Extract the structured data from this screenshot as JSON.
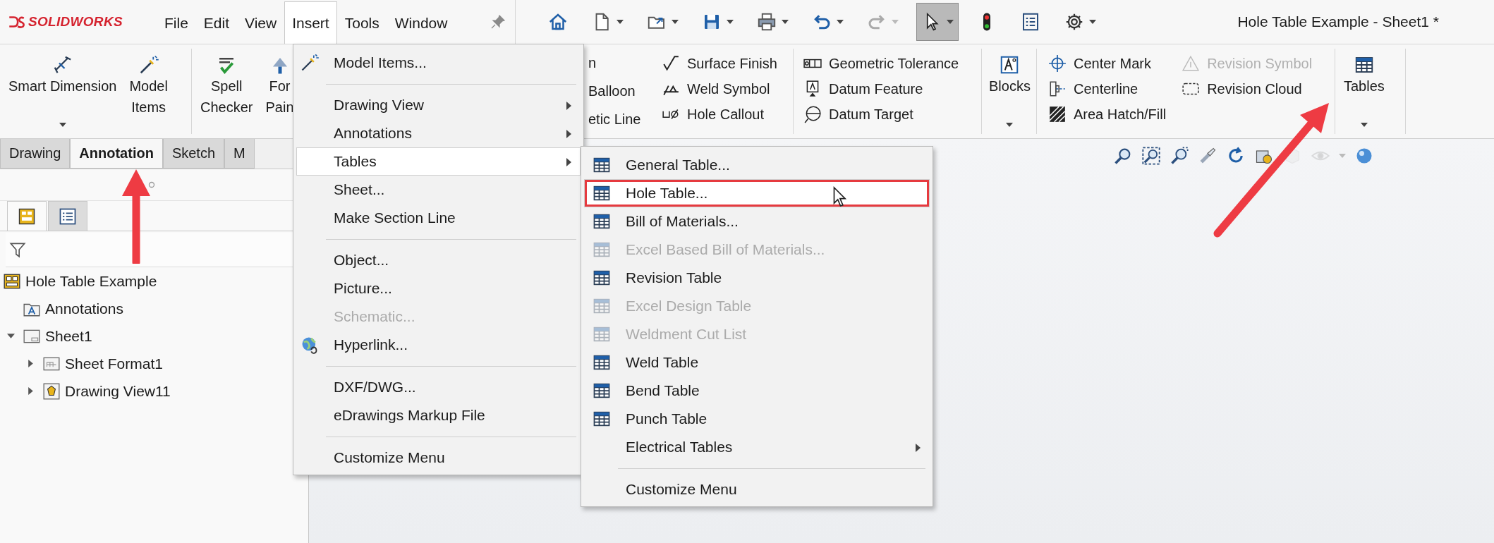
{
  "logo": "SOLIDWORKS",
  "menu_bar": [
    {
      "label": "File",
      "selected": false
    },
    {
      "label": "Edit",
      "selected": false
    },
    {
      "label": "View",
      "selected": false
    },
    {
      "label": "Insert",
      "selected": true
    },
    {
      "label": "Tools",
      "selected": false
    },
    {
      "label": "Window",
      "selected": false
    }
  ],
  "quick_access": [
    {
      "dropdown": false,
      "selected": false,
      "disabled": false
    },
    {
      "dropdown": true,
      "selected": false,
      "disabled": false
    },
    {
      "dropdown": true,
      "selected": false,
      "disabled": false
    },
    {
      "dropdown": true,
      "selected": false,
      "disabled": false
    },
    {
      "dropdown": true,
      "selected": false,
      "disabled": false
    },
    {
      "dropdown": true,
      "selected": false,
      "disabled": false
    },
    {
      "dropdown": true,
      "selected": false,
      "disabled": true
    },
    {
      "dropdown": true,
      "selected": true,
      "disabled": false
    },
    {
      "dropdown": false,
      "selected": false,
      "disabled": false
    },
    {
      "dropdown": false,
      "selected": false,
      "disabled": false
    },
    {
      "dropdown": true,
      "selected": false,
      "disabled": false
    }
  ],
  "window_title": "Hole Table Example - Sheet1 *",
  "ribbon": [
    {
      "kind": "large",
      "items": [
        {
          "lines": [
            "Smart Dimension"
          ],
          "dropdown": true
        },
        {
          "lines": [
            "Model",
            "Items"
          ],
          "dropdown": false
        }
      ]
    },
    {
      "kind": "large",
      "items": [
        {
          "lines": [
            "Spell",
            "Checker"
          ],
          "dropdown": false
        },
        {
          "lines": [
            "For",
            "Pain"
          ],
          "dropdown": false
        }
      ]
    },
    {
      "kind": "partial",
      "columns": [
        [
          {
            "label": "n"
          },
          {
            "label": "Balloon"
          },
          {
            "label": "etic Line"
          }
        ]
      ]
    },
    {
      "kind": "small",
      "columns": [
        [
          {
            "label": "Surface Finish",
            "disabled": false
          },
          {
            "label": "Weld Symbol",
            "disabled": false
          },
          {
            "label": "Hole Callout",
            "disabled": false
          }
        ]
      ]
    },
    {
      "kind": "small",
      "columns": [
        [
          {
            "label": "Geometric Tolerance",
            "disabled": false
          },
          {
            "label": "Datum Feature",
            "disabled": false
          },
          {
            "label": "Datum Target",
            "disabled": false
          }
        ]
      ]
    },
    {
      "kind": "large",
      "items": [
        {
          "lines": [
            "Blocks"
          ],
          "dropdown": true
        }
      ]
    },
    {
      "kind": "small",
      "columns": [
        [
          {
            "label": "Center Mark",
            "disabled": false
          },
          {
            "label": "Centerline",
            "disabled": false
          },
          {
            "label": "Area Hatch/Fill",
            "disabled": false
          }
        ],
        [
          {
            "label": "Revision Symbol",
            "disabled": true
          },
          {
            "label": "Revision Cloud",
            "disabled": false
          }
        ]
      ]
    },
    {
      "kind": "large",
      "items": [
        {
          "lines": [
            "Tables"
          ],
          "dropdown": true
        }
      ]
    }
  ],
  "tabs": [
    {
      "label": "Drawing",
      "selected": false
    },
    {
      "label": "Annotation",
      "selected": true
    },
    {
      "label": "Sketch",
      "selected": false
    },
    {
      "label": "M",
      "selected": false
    }
  ],
  "panel_tabs": [
    {
      "selected": true
    },
    {
      "selected": false
    }
  ],
  "tree": [
    {
      "label": "Hole Table Example",
      "children": [
        {
          "label": "Annotations"
        },
        {
          "label": "Sheet1",
          "expanded": true,
          "children": [
            {
              "label": "Sheet Format1",
              "expanded": false
            },
            {
              "label": "Drawing View11",
              "expanded": false
            }
          ]
        }
      ]
    }
  ],
  "insert_menu": [
    {
      "kind": "item",
      "label": "Model Items...",
      "disabled": false,
      "submenu": false,
      "selected": false
    },
    {
      "kind": "separator"
    },
    {
      "kind": "item",
      "label": "Drawing View",
      "disabled": false,
      "submenu": true,
      "selected": false
    },
    {
      "kind": "item",
      "label": "Annotations",
      "disabled": false,
      "submenu": true,
      "selected": false
    },
    {
      "kind": "item",
      "label": "Tables",
      "disabled": false,
      "submenu": true,
      "selected": true
    },
    {
      "kind": "item",
      "label": "Sheet...",
      "disabled": false,
      "submenu": false,
      "selected": false
    },
    {
      "kind": "item",
      "label": "Make Section Line",
      "disabled": false,
      "submenu": false,
      "selected": false
    },
    {
      "kind": "separator"
    },
    {
      "kind": "item",
      "label": "Object...",
      "disabled": false,
      "submenu": false,
      "selected": false
    },
    {
      "kind": "item",
      "label": "Picture...",
      "disabled": false,
      "submenu": false,
      "selected": false
    },
    {
      "kind": "item",
      "label": "Schematic...",
      "disabled": true,
      "submenu": false,
      "selected": false
    },
    {
      "kind": "item",
      "label": "Hyperlink...",
      "disabled": false,
      "submenu": false,
      "selected": false
    },
    {
      "kind": "separator"
    },
    {
      "kind": "item",
      "label": "DXF/DWG...",
      "disabled": false,
      "submenu": false,
      "selected": false
    },
    {
      "kind": "item",
      "label": "eDrawings Markup File",
      "disabled": false,
      "submenu": false,
      "selected": false
    },
    {
      "kind": "separator"
    },
    {
      "kind": "item",
      "label": "Customize Menu",
      "disabled": false,
      "submenu": false,
      "selected": false
    }
  ],
  "tables_menu": [
    {
      "kind": "item",
      "label": "General Table...",
      "disabled": false,
      "submenu": false,
      "selected": false,
      "callout": false
    },
    {
      "kind": "item",
      "label": "Hole Table...",
      "disabled": false,
      "submenu": false,
      "selected": true,
      "callout": true
    },
    {
      "kind": "item",
      "label": "Bill of Materials...",
      "disabled": false,
      "submenu": false,
      "selected": false,
      "callout": false
    },
    {
      "kind": "item",
      "label": "Excel Based Bill of Materials...",
      "disabled": true,
      "submenu": false,
      "selected": false,
      "callout": false
    },
    {
      "kind": "item",
      "label": "Revision Table",
      "disabled": false,
      "submenu": false,
      "selected": false,
      "callout": false
    },
    {
      "kind": "item",
      "label": "Excel Design Table",
      "disabled": true,
      "submenu": false,
      "selected": false,
      "callout": false
    },
    {
      "kind": "item",
      "label": "Weldment Cut List",
      "disabled": true,
      "submenu": false,
      "selected": false,
      "callout": false
    },
    {
      "kind": "item",
      "label": "Weld Table",
      "disabled": false,
      "submenu": false,
      "selected": false,
      "callout": false
    },
    {
      "kind": "item",
      "label": "Bend Table",
      "disabled": false,
      "submenu": false,
      "selected": false,
      "callout": false
    },
    {
      "kind": "item",
      "label": "Punch Table",
      "disabled": false,
      "submenu": false,
      "selected": false,
      "callout": false
    },
    {
      "kind": "item",
      "label": "Electrical Tables",
      "disabled": false,
      "submenu": true,
      "selected": false,
      "callout": false
    },
    {
      "kind": "separator"
    },
    {
      "kind": "item",
      "label": "Customize Menu",
      "disabled": false,
      "submenu": false,
      "selected": false,
      "callout": false
    }
  ],
  "callouts": [
    {
      "kind": "arrow"
    },
    {
      "kind": "arrow"
    }
  ]
}
